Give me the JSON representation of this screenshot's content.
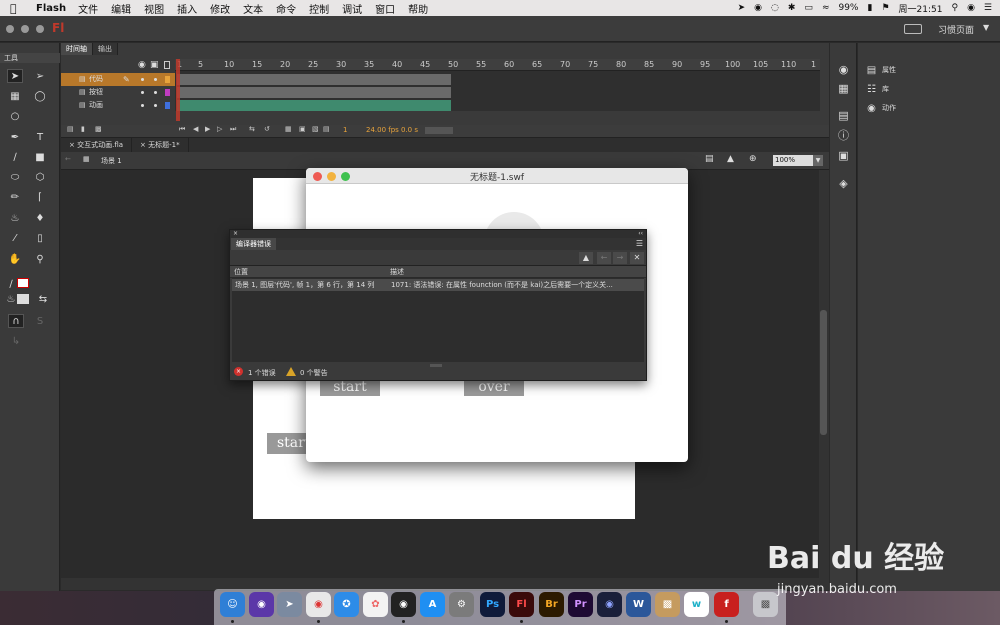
{
  "menubar": {
    "app": "Flash",
    "items": [
      "文件",
      "编辑",
      "视图",
      "插入",
      "修改",
      "文本",
      "命令",
      "控制",
      "调试",
      "窗口",
      "帮助"
    ],
    "battery": "99%",
    "clock": "周一21:51"
  },
  "apptitle": {
    "app_badge": "Fl",
    "workspace": "习惯页面"
  },
  "tools": {
    "header": "工具"
  },
  "timeline": {
    "tabs": [
      "时间轴",
      "输出"
    ],
    "ticks": [
      "1",
      "5",
      "10",
      "15",
      "20",
      "25",
      "30",
      "35",
      "40",
      "45",
      "50",
      "55",
      "60",
      "65",
      "70",
      "75",
      "80",
      "85",
      "90",
      "95",
      "100",
      "105",
      "110",
      "1"
    ],
    "layers": [
      {
        "name": "代码",
        "color": "#e8a33b"
      },
      {
        "name": "按钮",
        "color": "#c03cc0"
      },
      {
        "name": "动画",
        "color": "#3f6fdc"
      }
    ],
    "footer": {
      "frame": "1",
      "fps": "24.00 fps",
      "time": "0.0 s"
    }
  },
  "doctabs": [
    "交互式动画.fla",
    "无标题-1*"
  ],
  "editbar": {
    "scene": "场景 1",
    "zoom": "100%"
  },
  "stage": {
    "start_label": "start"
  },
  "swf": {
    "title": "无标题-1.swf",
    "start_label": "start",
    "over_label": "over"
  },
  "compiler": {
    "title": "编译器错误",
    "col_location": "位置",
    "col_desc": "描述",
    "row_location": "场景 1, 图层'代码', 帧 1，第 6 行，第 14 列",
    "row_desc": "1071: 语法错误: 在属性 founction (而不是 kai)之后需要一个定义关...",
    "errors": "1 个错误",
    "warnings": "0 个警告"
  },
  "rightpanel": {
    "items": [
      "属性",
      "库",
      "动作"
    ]
  },
  "watermark": {
    "brand": "Bai du 经验",
    "url": "jingyan.baidu.com"
  }
}
